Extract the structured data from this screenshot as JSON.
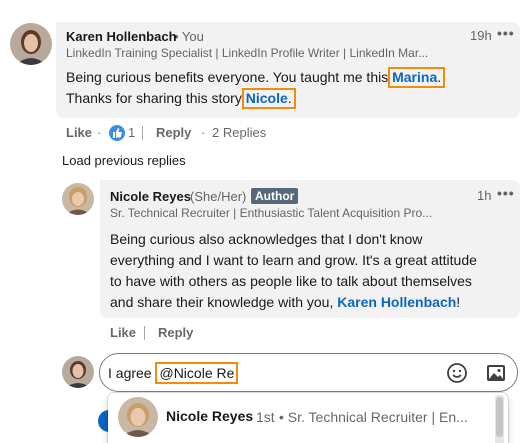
{
  "colors": {
    "link_blue": "#0a66c2",
    "highlight_orange": "#f28c0f",
    "bubble_bg": "#f2f2f2",
    "author_badge": "#56687a"
  },
  "comment1": {
    "name": "Karen Hollenbach",
    "you_label": "• You",
    "time": "19h",
    "headline": "LinkedIn Training Specialist | LinkedIn Profile Writer | LinkedIn Mar...",
    "text_part1": "Being curious benefits everyone. You taught me this ",
    "mention1": "Marina",
    "text_part1_end": ".",
    "text_part2": "Thanks for sharing this story ",
    "mention2": "Nicole",
    "text_part2_end": ".",
    "actions": {
      "like": "Like",
      "reaction_count": "1",
      "reply": "Reply",
      "replies": "2 Replies",
      "dot": "·"
    },
    "reaction_icon": "thumbs-up-icon"
  },
  "load_previous": "Load previous replies",
  "reply1": {
    "name": "Nicole Reyes",
    "pronouns": "(She/Her)",
    "badge": "Author",
    "time": "1h",
    "headline": "Sr. Technical Recruiter | Enthusiastic Talent Acquisition Pro...",
    "line1": "Being curious also acknowledges that I don't know",
    "line2": "everything and I want to learn and grow. It's a great attitude",
    "line3": "to have with others as people like to talk about themselves",
    "line4_prefix": "and share their knowledge with you, ",
    "line4_mention": "Karen Hollenbach",
    "line4_suffix": "!",
    "actions": {
      "like": "Like",
      "reply": "Reply"
    }
  },
  "composer": {
    "text_prefix": "I agree ",
    "mention_typed": "@Nicole Re",
    "emoji_icon": "smiley-icon",
    "image_icon": "image-icon"
  },
  "suggestion": {
    "name": "Nicole Reyes",
    "degree": "1st",
    "headline": "• Sr. Technical Recruiter | En..."
  }
}
